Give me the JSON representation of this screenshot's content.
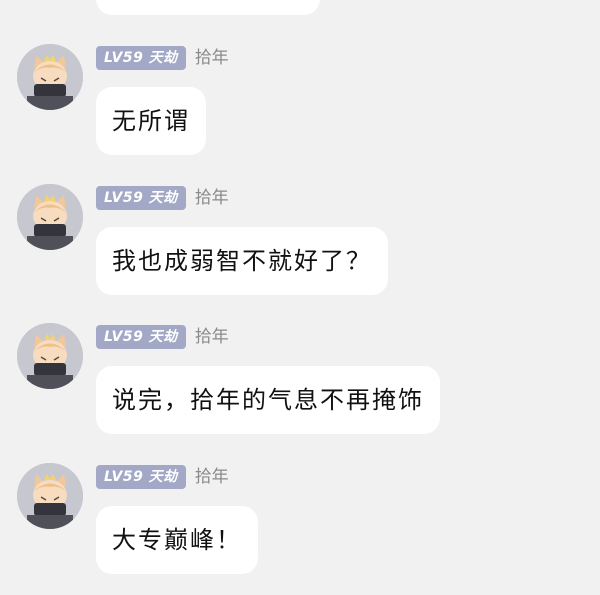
{
  "messages": [
    {
      "level_badge": "LV59 天劫",
      "username": "拾年",
      "text": "无所谓"
    },
    {
      "level_badge": "LV59 天劫",
      "username": "拾年",
      "text": "我也成弱智不就好了？"
    },
    {
      "level_badge": "LV59 天劫",
      "username": "拾年",
      "text": "说完，拾年的气息不再掩饰"
    },
    {
      "level_badge": "LV59 天劫",
      "username": "拾年",
      "text": "大专巅峰！"
    }
  ]
}
